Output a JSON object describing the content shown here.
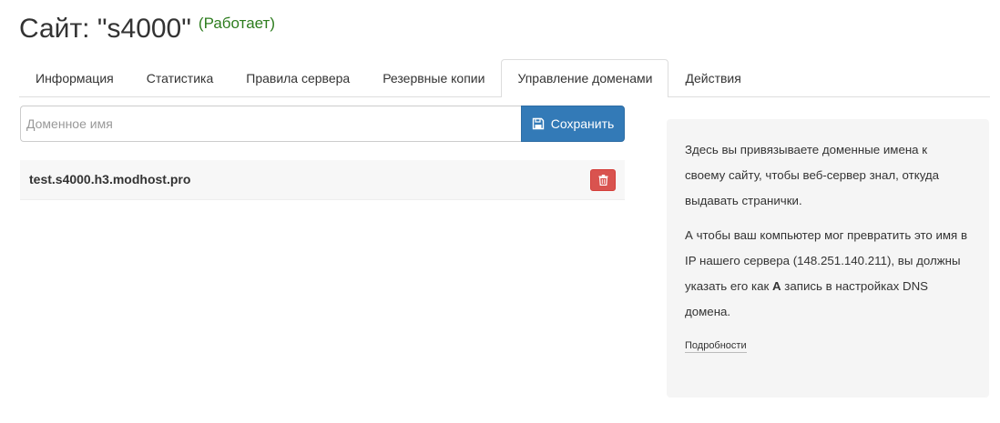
{
  "header": {
    "title": "Сайт: \"s4000\"",
    "status": "(Работает)"
  },
  "tabs": [
    {
      "label": "Информация",
      "active": false
    },
    {
      "label": "Статистика",
      "active": false
    },
    {
      "label": "Правила сервера",
      "active": false
    },
    {
      "label": "Резервные копии",
      "active": false
    },
    {
      "label": "Управление доменами",
      "active": true
    },
    {
      "label": "Действия",
      "active": false
    }
  ],
  "domain_form": {
    "placeholder": "Доменное имя",
    "value": "",
    "save_label": "Сохранить"
  },
  "domains": [
    {
      "name": "test.s4000.h3.modhost.pro"
    }
  ],
  "info": {
    "paragraph1": "Здесь вы привязываете доменные имена к своему сайту, чтобы веб-сервер знал, откуда выдавать странички.",
    "paragraph2_before": "А чтобы ваш компьютер мог превратить это имя в IP нашего сервера (148.251.140.211), вы должны указать его как ",
    "paragraph2_bold": "A",
    "paragraph2_after": " запись в настройках DNS домена.",
    "details_link": "Подробности"
  },
  "colors": {
    "primary": "#337ab7",
    "danger": "#d9534f",
    "status_ok": "#2e7d1f",
    "panel_bg": "#f5f5f5"
  },
  "icons": {
    "save": "floppy-disk-icon",
    "delete": "trash-icon"
  }
}
